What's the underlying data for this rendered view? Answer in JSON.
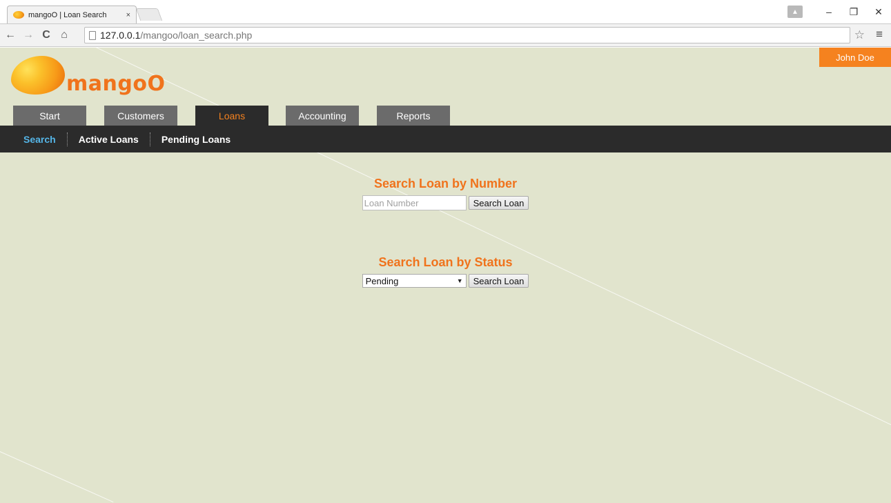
{
  "browser": {
    "tab_title": "mangoO | Loan Search",
    "tab_close": "×",
    "url_host": "127.0.0.1",
    "url_path": "/mangoo/loan_search.php",
    "window_controls": {
      "minimize": "–",
      "restore": "❐",
      "close": "✕"
    },
    "icons": {
      "back": "back-arrow-icon",
      "forward": "forward-arrow-icon",
      "reload": "reload-icon",
      "home": "home-icon",
      "bookmark": "star-icon",
      "menu": "hamburger-menu-icon"
    }
  },
  "header": {
    "logo_text": "mangoO",
    "user_name": "John Doe"
  },
  "main_tabs": [
    {
      "label": "Start",
      "active": false
    },
    {
      "label": "Customers",
      "active": false
    },
    {
      "label": "Loans",
      "active": true
    },
    {
      "label": "Accounting",
      "active": false
    },
    {
      "label": "Reports",
      "active": false
    }
  ],
  "sub_nav": [
    {
      "label": "Search",
      "active": true
    },
    {
      "label": "Active Loans",
      "active": false
    },
    {
      "label": "Pending Loans",
      "active": false
    }
  ],
  "search_by_number": {
    "title": "Search Loan by Number",
    "placeholder": "Loan Number",
    "button_label": "Search Loan"
  },
  "search_by_status": {
    "title": "Search Loan by Status",
    "selected_value": "Pending",
    "button_label": "Search Loan"
  },
  "colors": {
    "page_background": "#e1e4cd",
    "accent_orange": "#f5821f",
    "nav_dark": "#2b2b2b",
    "tab_gray": "#6b6b6b",
    "subnav_active": "#55b6e8"
  }
}
